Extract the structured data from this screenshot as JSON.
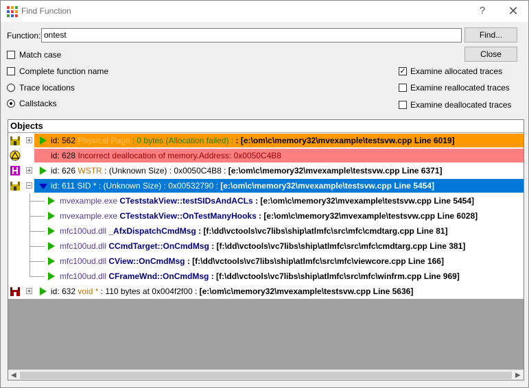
{
  "window": {
    "title": "Find Function",
    "help_glyph": "?",
    "close_glyph": "✕"
  },
  "form": {
    "function_label": "Function:",
    "function_value": "ontest",
    "find_button": "Find...",
    "close_button": "Close",
    "match_case": {
      "label": "Match case",
      "checked": false
    },
    "complete_name": {
      "label": "Complete function name",
      "checked": false
    },
    "trace_locations": {
      "label": "Trace locations",
      "selected": false
    },
    "callstacks": {
      "label": "Callstacks",
      "selected": true
    },
    "examine_allocated": {
      "label": "Examine allocated traces",
      "checked": true
    },
    "examine_reallocated": {
      "label": "Examine reallocated traces",
      "checked": false
    },
    "examine_deallocated": {
      "label": "Examine deallocated traces",
      "checked": false
    }
  },
  "tree": {
    "header": "Objects",
    "rows": [
      {
        "id": "id: 562 ",
        "kind": "Physical Page",
        "size": " : 0 bytes (Allocation failed) : ",
        "location": " : [e:\\om\\c\\memory32\\mvexample\\testsvw.cpp Line 6019]",
        "band_color": "#ff9900",
        "icon": "factory-icon"
      },
      {
        "id": "id: 628 ",
        "text": "Incorrect deallocation of memory.Address: 0x0050C4B8",
        "band_color": "#ff8080",
        "icon": "warning-icon"
      },
      {
        "id": "id: 626 ",
        "kind": "WSTR",
        "size": " : (Unknown Size) :  0x0050C4B8 : ",
        "location": "[e:\\om\\c\\memory32\\mvexample\\testsvw.cpp Line 6371]",
        "icon": "heap-icon"
      },
      {
        "id": "id: 611 ",
        "kind": "SID *",
        "size": " : (Unknown Size) : 0x00532790 : ",
        "location": "[e:\\om\\c\\memory32\\mvexample\\testsvw.cpp Line 5454]",
        "band_color": "#0078d7",
        "icon": "factory-icon"
      },
      {
        "module": "mvexample.exe ",
        "func": "CTeststakView::testSIDsAndACLs",
        "location": " : [e:\\om\\c\\memory32\\mvexample\\testsvw.cpp Line 5454]"
      },
      {
        "module": "mvexample.exe ",
        "func": "CTeststakView::OnTestManyHooks",
        "location": " : [e:\\om\\c\\memory32\\mvexample\\testsvw.cpp Line 6028]"
      },
      {
        "module": "mfc100ud.dll ",
        "func": "_AfxDispatchCmdMsg",
        "location": " : [f:\\dd\\vctools\\vc7libs\\ship\\atlmfc\\src\\mfc\\cmdtarg.cpp Line 81]"
      },
      {
        "module": "mfc100ud.dll ",
        "func": "CCmdTarget::OnCmdMsg",
        "location": " : [f:\\dd\\vctools\\vc7libs\\ship\\atlmfc\\src\\mfc\\cmdtarg.cpp Line 381]"
      },
      {
        "module": "mfc100ud.dll ",
        "func": "CView::OnCmdMsg",
        "location": " : [f:\\dd\\vctools\\vc7libs\\ship\\atlmfc\\src\\mfc\\viewcore.cpp Line 166]"
      },
      {
        "module": "mfc100ud.dll ",
        "func": "CFrameWnd::OnCmdMsg",
        "location": " : [f:\\dd\\vctools\\vc7libs\\ship\\atlmfc\\src\\mfc\\winfrm.cpp Line 969]"
      },
      {
        "id": "id: 632 ",
        "kind": "void *",
        "size": " : 110 bytes at 0x004f2f00 : ",
        "location": "[e:\\om\\c\\memory32\\mvexample\\testsvw.cpp Line 5636]",
        "icon": "factory-red-icon"
      }
    ]
  },
  "colors": {
    "orange_band": "#ff9900",
    "pink_band": "#ff8080",
    "selected_band": "#0078d7",
    "play_green": "#22b000"
  }
}
